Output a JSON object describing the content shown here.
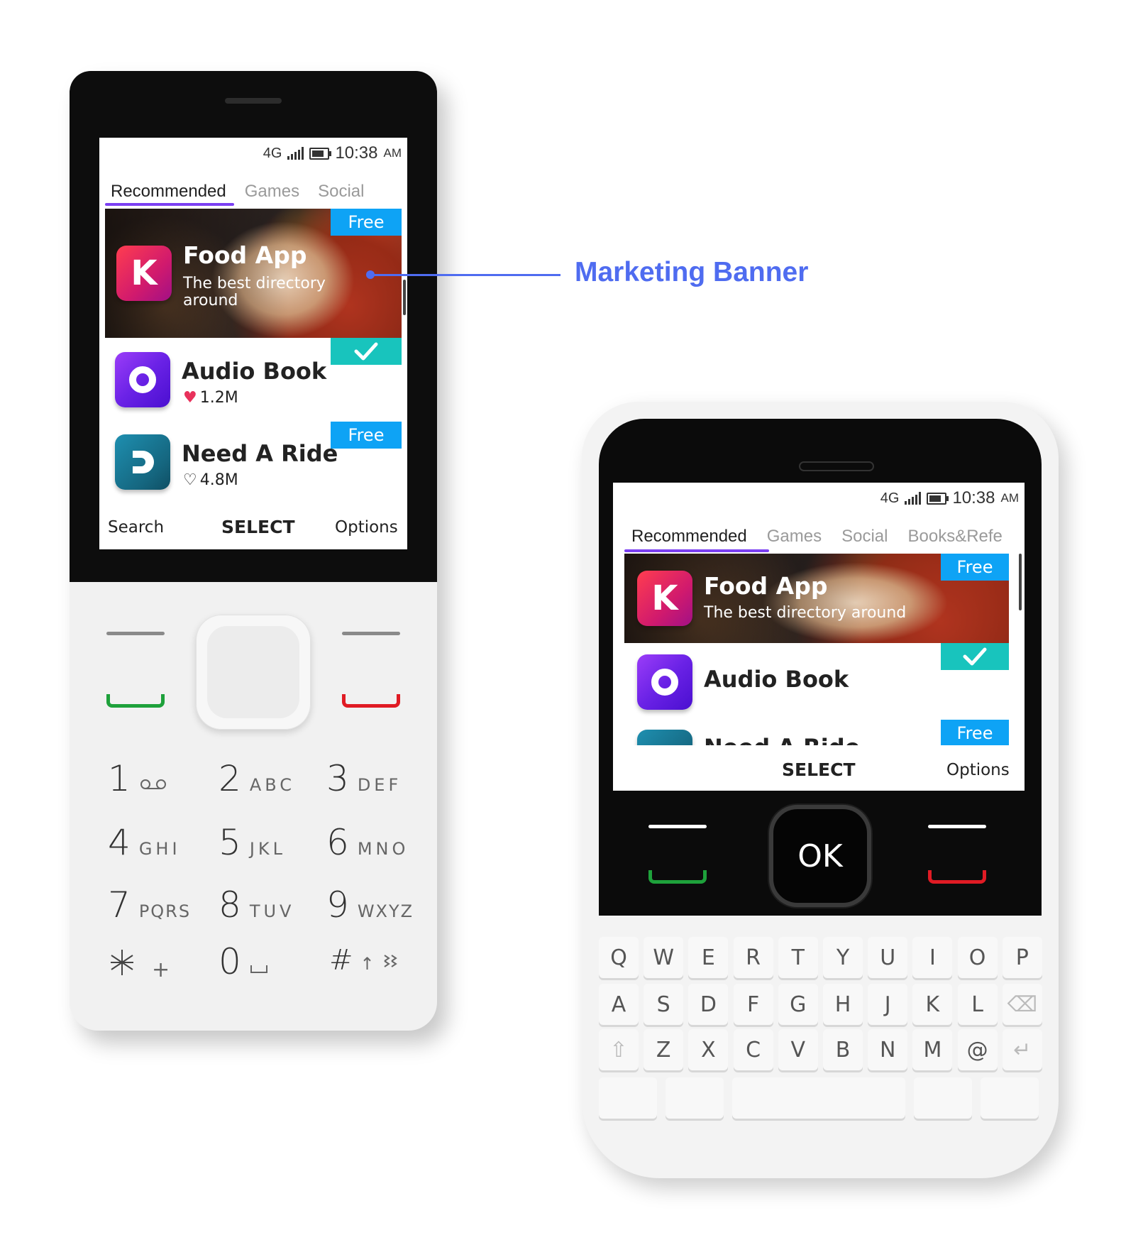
{
  "annotation": {
    "label": "Marketing Banner"
  },
  "status": {
    "network": "4G",
    "time": "10:38",
    "ampm": "AM"
  },
  "phone1": {
    "tabs": [
      "Recommended",
      "Games",
      "Social"
    ],
    "banner": {
      "badge": "Free",
      "title": "Food App",
      "subtitle_line1": "The best directory",
      "subtitle_line2": "around",
      "icon_letter": "K"
    },
    "apps": [
      {
        "title": "Audio Book",
        "likes": "1.2M",
        "liked": true,
        "badge": "check-icon"
      },
      {
        "title": "Need A Ride",
        "likes": "4.8M",
        "liked": false,
        "badge": "Free"
      }
    ],
    "softkeys": {
      "left": "Search",
      "center": "SELECT",
      "right": "Options"
    },
    "keypad": [
      {
        "digit": "1",
        "letters": ""
      },
      {
        "digit": "2",
        "letters": "ABC"
      },
      {
        "digit": "3",
        "letters": "DEF"
      },
      {
        "digit": "4",
        "letters": "GHI"
      },
      {
        "digit": "5",
        "letters": "JKL"
      },
      {
        "digit": "6",
        "letters": "MNO"
      },
      {
        "digit": "7",
        "letters": "PQRS"
      },
      {
        "digit": "8",
        "letters": "TUV"
      },
      {
        "digit": "9",
        "letters": "WXYZ"
      },
      {
        "digit": "*",
        "letters": "+"
      },
      {
        "digit": "0",
        "letters": ""
      },
      {
        "digit": "#",
        "letters": ""
      }
    ]
  },
  "phone2": {
    "tabs": [
      "Recommended",
      "Games",
      "Social",
      "Books&Refe"
    ],
    "banner": {
      "badge": "Free",
      "title": "Food App",
      "subtitle": "The best directory around"
    },
    "apps": [
      {
        "title": "Audio Book",
        "badge": "check-icon"
      },
      {
        "title": "Need A Ride",
        "badge": "Free"
      }
    ],
    "softkeys": {
      "center": "SELECT",
      "right": "Options"
    },
    "ok_label": "OK",
    "keyboard_rows": [
      [
        "Q",
        "W",
        "E",
        "R",
        "T",
        "Y",
        "U",
        "I",
        "O",
        "P"
      ],
      [
        "A",
        "S",
        "D",
        "F",
        "G",
        "H",
        "J",
        "K",
        "L",
        "⌫"
      ],
      [
        "⇧",
        "Z",
        "X",
        "C",
        "V",
        "B",
        "N",
        "M",
        "@",
        "↵"
      ]
    ]
  },
  "colors": {
    "accent": "#7b3ff2",
    "badge_blue": "#0ea3f5",
    "badge_teal": "#18c4bd",
    "callout": "#4f6cf0",
    "call_green": "#1ea13b",
    "end_red": "#e01b24"
  }
}
